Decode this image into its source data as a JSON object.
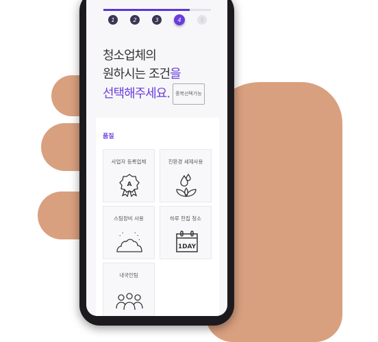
{
  "progress": {
    "current": 4,
    "total": 5,
    "fraction": 0.8
  },
  "steps": [
    "1",
    "2",
    "3",
    "4",
    "5"
  ],
  "title": {
    "line1": "청소업체의",
    "line2a": "원하시는 조건",
    "line2b": "을",
    "line3": "선택해주세요.",
    "tag": "중복선택가능"
  },
  "section": "품질",
  "options": [
    "사업자 등록업체",
    "친환경 세제사용",
    "스팀장비 사용",
    "하루 한집 청소",
    "내국인팀"
  ],
  "icon_text": {
    "badge": "A",
    "day": "1DAY"
  },
  "colors": {
    "accent": "#6a3ddc",
    "dark": "#3a3654"
  }
}
